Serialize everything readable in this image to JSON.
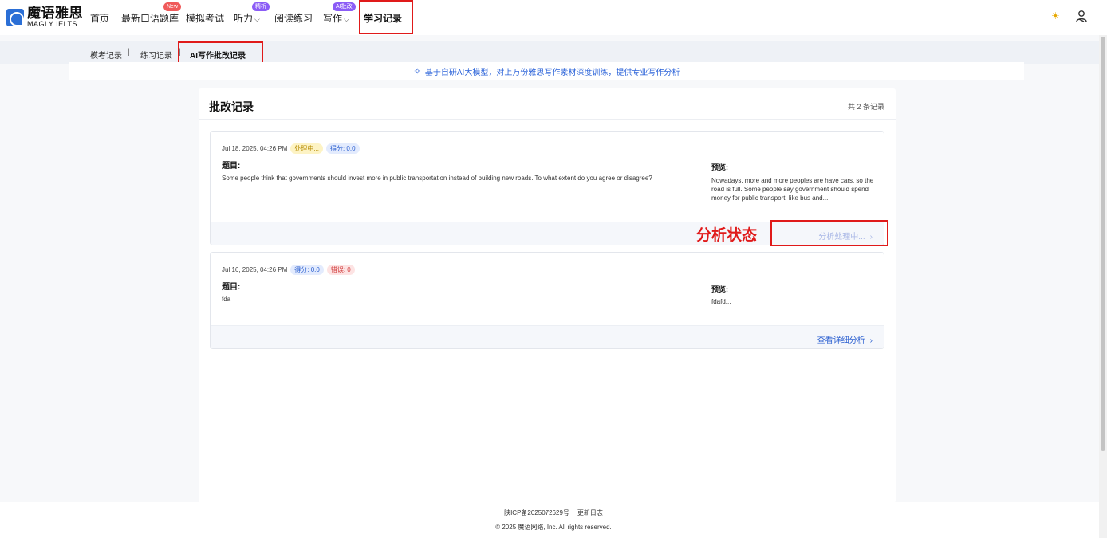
{
  "header": {
    "logo_cn": "魔语雅思",
    "logo_en": "MAGLY IELTS",
    "nav": [
      {
        "label": "首页",
        "badge": ""
      },
      {
        "label": "最新口语题库",
        "badge": "New"
      },
      {
        "label": "模拟考试",
        "badge": ""
      },
      {
        "label": "听力",
        "badge": "精析"
      },
      {
        "label": "阅读练习",
        "badge": ""
      },
      {
        "label": "写作",
        "badge": "AI批改"
      },
      {
        "label": "学习记录",
        "badge": ""
      }
    ]
  },
  "subnav": {
    "items": [
      "模考记录",
      "练习记录",
      "AI写作批改记录"
    ],
    "separator": "|"
  },
  "banner": {
    "text": "基于自研AI大模型，对上万份雅思写作素材深度训练，提供专业写作分析"
  },
  "records_panel": {
    "title": "批改记录",
    "count_text": "共 2 条记录"
  },
  "records": [
    {
      "date": "Jul 18, 2025, 04:26 PM",
      "tags": [
        "处理中...",
        "得分: 0.0"
      ],
      "question_label": "题目:",
      "question": "Some people think that governments should invest more in public transportation instead of building new roads. To what extent do you agree or disagree?",
      "preview_label": "预览:",
      "preview": "Nowadays, more and more peoples are have cars, so the road is full. Some people say government should spend money for public transport, like bus and...",
      "action": "分析处理中..."
    },
    {
      "date": "Jul 16, 2025, 04:26 PM",
      "tags": [
        "得分: 0.0",
        "错误: 0"
      ],
      "question_label": "题目:",
      "question": "fda",
      "preview_label": "预览:",
      "preview": "fdafd...",
      "action": "查看详细分析"
    }
  ],
  "annotation": {
    "label": "分析状态"
  },
  "footer": {
    "icp": "陕ICP备2025072629号",
    "changelog": "更新日志",
    "copyright": "© 2025 魔语网络, Inc. All rights reserved."
  },
  "colors": {
    "accent": "#2b5fd0",
    "annotation_red": "#e01a1a",
    "badge_new": "#f05a5a",
    "badge_purple": "#8b5cf6"
  }
}
